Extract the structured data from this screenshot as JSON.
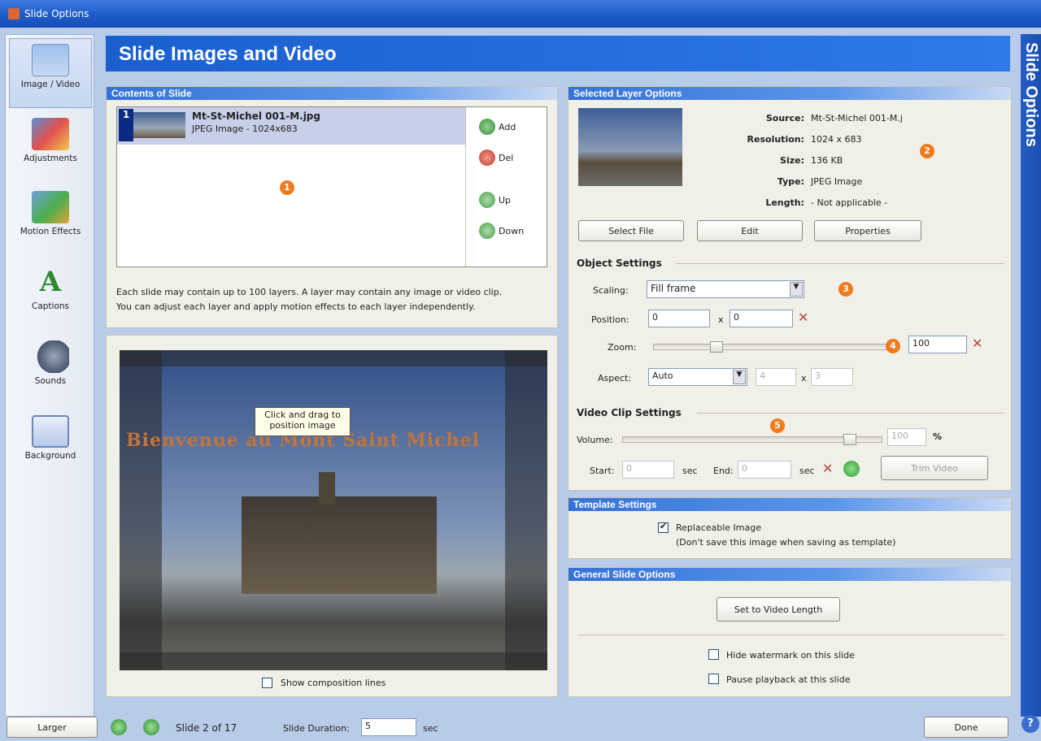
{
  "window": {
    "title": "Slide Options"
  },
  "sidebar": {
    "items": [
      {
        "label": "Image / Video",
        "icon": "image-video-icon",
        "active": true
      },
      {
        "label": "Adjustments",
        "icon": "adjustments-icon"
      },
      {
        "label": "Motion Effects",
        "icon": "motion-effects-icon"
      },
      {
        "label": "Captions",
        "icon": "captions-icon"
      },
      {
        "label": "Sounds",
        "icon": "sounds-icon"
      },
      {
        "label": "Background",
        "icon": "background-icon"
      }
    ]
  },
  "header": {
    "title": "Slide Images and Video"
  },
  "side_strip": {
    "label": "Slide Options"
  },
  "contents": {
    "title": "Contents of Slide",
    "layer": {
      "number": "1",
      "name": "Mt-St-Michel 001-M.jpg",
      "info": "JPEG Image - 1024x683"
    },
    "buttons": {
      "add": "Add",
      "del": "Del",
      "up": "Up",
      "down": "Down"
    },
    "note1": "Each slide may contain up to 100 layers. A layer may contain any image or video clip.",
    "note2": "You can adjust each layer and apply motion effects to each layer independently.",
    "marker": "1"
  },
  "preview": {
    "caption": "Bienvenue au Mont Saint Michel",
    "tooltip1": "Click and drag to",
    "tooltip2": "position image",
    "show_lines": "Show composition lines"
  },
  "selected_layer": {
    "title": "Selected Layer Options",
    "source_label": "Source:",
    "source": "Mt-St-Michel 001-M.j",
    "resolution_label": "Resolution:",
    "resolution": "1024 x 683",
    "size_label": "Size:",
    "size": "136 KB",
    "type_label": "Type:",
    "type": "JPEG Image",
    "length_label": "Length:",
    "length": "- Not applicable -",
    "select_file": "Select File",
    "edit": "Edit",
    "properties": "Properties",
    "marker": "2"
  },
  "object_settings": {
    "title": "Object Settings",
    "scaling_label": "Scaling:",
    "scaling": "Fill frame",
    "position_label": "Position:",
    "pos_x": "0",
    "pos_y": "0",
    "x": "x",
    "zoom_label": "Zoom:",
    "zoom": "100",
    "zoom_level": 0.25,
    "aspect_label": "Aspect:",
    "aspect": "Auto",
    "aspect_w": "4",
    "aspect_h": "3",
    "marker3": "3",
    "marker4": "4"
  },
  "video_settings": {
    "title": "Video Clip Settings",
    "volume_label": "Volume:",
    "volume": "100",
    "percent": "%",
    "start_label": "Start:",
    "start": "0",
    "sec": "sec",
    "end_label": "End:",
    "end": "0",
    "sec2": "sec",
    "trim": "Trim Video",
    "marker": "5"
  },
  "template": {
    "title": "Template Settings",
    "replaceable": "Replaceable Image",
    "note": "(Don't save this image when saving as template)"
  },
  "general": {
    "title": "General Slide Options",
    "set_video": "Set to Video Length",
    "hide_watermark": "Hide watermark on this slide",
    "pause": "Pause playback at this slide"
  },
  "bottom": {
    "larger": "Larger",
    "slide_info": "Slide 2 of 17",
    "duration_label": "Slide Duration:",
    "duration": "5",
    "sec": "sec",
    "done": "Done"
  },
  "colors": {
    "accent": "#1b5fcf",
    "marker": "#f07a1c"
  }
}
